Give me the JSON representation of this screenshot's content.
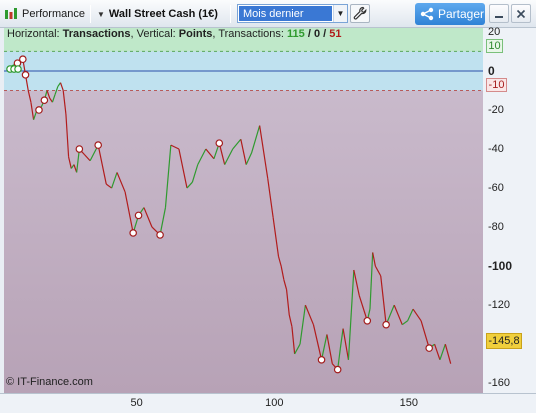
{
  "toolbar": {
    "performance_label": "Performance",
    "instrument_label": "Wall Street Cash (1€)",
    "period_value": "Mois dernier",
    "share_label": "Partager",
    "icons": [
      "bar-chart-icon",
      "dropdown-caret-icon",
      "wrench-icon",
      "share-icon",
      "minimize-icon",
      "close-icon"
    ]
  },
  "legend": {
    "prefix_horizontal": "Horizontal: ",
    "horizontal_value": "Transactions",
    "prefix_vertical": ", Vertical: ",
    "vertical_value": "Points",
    "prefix_transactions": ", Transactions: ",
    "wins": "115",
    "sep1": " / ",
    "neutral": "0",
    "sep2": " / ",
    "losses": "51"
  },
  "copyright": "© IT-Finance.com",
  "y_axis": {
    "ticks": [
      "20",
      "0",
      "-20",
      "-40",
      "-60",
      "-80",
      "-100",
      "-120",
      "-140",
      "-160"
    ],
    "upper_band_label": "10",
    "lower_band_label": "-10",
    "current_value_label": "-145,8"
  },
  "x_axis": {
    "ticks": [
      "50",
      "100",
      "150"
    ]
  },
  "colors": {
    "up": "#2f9a2f",
    "down": "#b11c1c",
    "band_top": "#bfe8c9",
    "band_zero": "#bfe1ef",
    "plot_bg_top": "#cdbfd0",
    "plot_bg_bottom": "#b7a2b6",
    "zero_line": "#2b4fa8",
    "current_badge": "#f0cf3c"
  },
  "chart_data": {
    "type": "line",
    "title": "",
    "xlabel": "Transactions",
    "ylabel": "Points",
    "xlim": [
      0,
      178
    ],
    "ylim": [
      -165,
      22
    ],
    "band_upper": 10,
    "band_lower": -10,
    "x": [
      2,
      5,
      7,
      8,
      9,
      10,
      11,
      12,
      13,
      14,
      15,
      16,
      17,
      18,
      19,
      20,
      21,
      22,
      23,
      24,
      25,
      26,
      27,
      28,
      30,
      32,
      35,
      38,
      40,
      42,
      45,
      48,
      50,
      52,
      55,
      58,
      60,
      62,
      65,
      68,
      70,
      72,
      75,
      78,
      80,
      82,
      85,
      88,
      90,
      92,
      95,
      98,
      100,
      102,
      103,
      104,
      105,
      106,
      107,
      108,
      110,
      112,
      115,
      118,
      120,
      122,
      124,
      125,
      126,
      128,
      130,
      132,
      135,
      136,
      137,
      138,
      140,
      142,
      145,
      148,
      150,
      152,
      155,
      158,
      160,
      162,
      164,
      166
    ],
    "y": [
      2,
      4,
      6,
      -2,
      -10,
      -16,
      -25,
      -21,
      -20,
      -18,
      -15,
      -10,
      -14,
      -16,
      -12,
      -8,
      -6,
      -10,
      -22,
      -44,
      -50,
      -48,
      -52,
      -40,
      -43,
      -46,
      -38,
      -58,
      -60,
      -52,
      -62,
      -83,
      -74,
      -70,
      -80,
      -84,
      -70,
      -38,
      -40,
      -60,
      -57,
      -48,
      -40,
      -45,
      -37,
      -48,
      -40,
      -35,
      -48,
      -42,
      -28,
      -55,
      -75,
      -95,
      -100,
      -107,
      -112,
      -125,
      -131,
      -145,
      -140,
      -120,
      -130,
      -148,
      -135,
      -150,
      -153,
      -142,
      -132,
      -148,
      -102,
      -115,
      -128,
      -122,
      -93,
      -100,
      -105,
      -130,
      -120,
      -130,
      -128,
      -122,
      -128,
      -142,
      -140,
      -148,
      -140,
      -150
    ]
  }
}
